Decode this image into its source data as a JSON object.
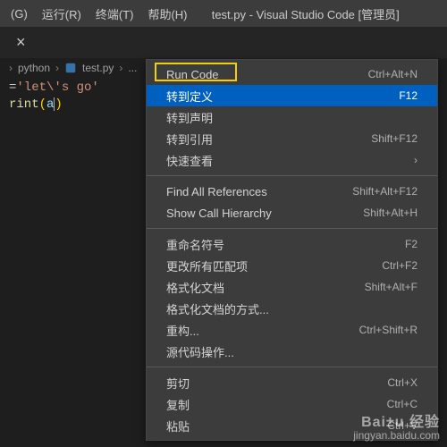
{
  "menubar": {
    "items": [
      {
        "label": "(G)"
      },
      {
        "label": "运行(R)"
      },
      {
        "label": "终端(T)"
      },
      {
        "label": "帮助(H)"
      }
    ],
    "title": "test.py - Visual Studio Code [管理员]"
  },
  "tab": {
    "close_glyph": "×"
  },
  "breadcrumb": {
    "folder": "python",
    "file": "test.py",
    "chevron": "›",
    "after": "..."
  },
  "code": {
    "line1_prefix": "=",
    "line1_str": "'let\\'s go'",
    "line2_func": "rint",
    "line2_open": "(",
    "line2_arg": "a",
    "line2_close": ")"
  },
  "contextMenu": {
    "items": [
      {
        "label": "Run Code",
        "shortcut": "Ctrl+Alt+N",
        "selected": false,
        "boxed": true
      },
      {
        "label": "转到定义",
        "shortcut": "F12",
        "selected": true
      },
      {
        "label": "转到声明",
        "shortcut": ""
      },
      {
        "label": "转到引用",
        "shortcut": "Shift+F12"
      },
      {
        "label": "快速查看",
        "shortcut": "›"
      },
      {
        "sep": true
      },
      {
        "label": "Find All References",
        "shortcut": "Shift+Alt+F12"
      },
      {
        "label": "Show Call Hierarchy",
        "shortcut": "Shift+Alt+H"
      },
      {
        "sep": true
      },
      {
        "label": "重命名符号",
        "shortcut": "F2"
      },
      {
        "label": "更改所有匹配项",
        "shortcut": "Ctrl+F2"
      },
      {
        "label": "格式化文档",
        "shortcut": "Shift+Alt+F"
      },
      {
        "label": "格式化文档的方式...",
        "shortcut": ""
      },
      {
        "label": "重构...",
        "shortcut": "Ctrl+Shift+R"
      },
      {
        "label": "源代码操作...",
        "shortcut": ""
      },
      {
        "sep": true
      },
      {
        "label": "剪切",
        "shortcut": "Ctrl+X"
      },
      {
        "label": "复制",
        "shortcut": "Ctrl+C"
      },
      {
        "label": "粘贴",
        "shortcut": "Ctrl+V"
      }
    ]
  },
  "watermark": {
    "big": "Bai±u 经验",
    "small": "jingyan.baidu.com"
  }
}
